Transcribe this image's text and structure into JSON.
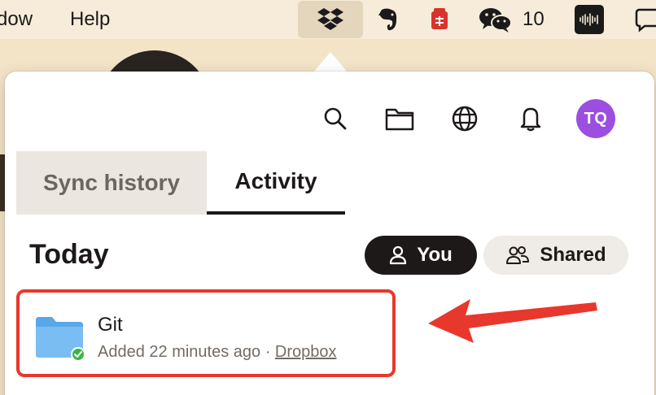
{
  "menubar": {
    "items": [
      "dow",
      "Help"
    ],
    "tray": {
      "dropbox": "dropbox-icon",
      "evernote": "evernote-icon",
      "note_app": "note-app-icon",
      "wechat": "wechat-icon",
      "wechat_count": "10",
      "audio": "audio-icon",
      "chat": "chat-icon"
    }
  },
  "toolbar": {
    "icons": [
      "search-icon",
      "folder-icon",
      "globe-icon",
      "bell-icon"
    ],
    "avatar_initials": "TQ",
    "avatar_color": "#9b4ee0"
  },
  "tabs": [
    {
      "label": "Sync history",
      "active": false
    },
    {
      "label": "Activity",
      "active": true
    }
  ],
  "activity": {
    "section_title": "Today",
    "filters": [
      {
        "label": "You",
        "active": true
      },
      {
        "label": "Shared",
        "active": false
      }
    ],
    "items": [
      {
        "name": "Git",
        "meta_prefix": "Added 22 minutes ago · ",
        "meta_link": "Dropbox",
        "icon": "folder-synced-icon"
      }
    ]
  },
  "annotation": {
    "highlight_color": "#e8372c"
  }
}
